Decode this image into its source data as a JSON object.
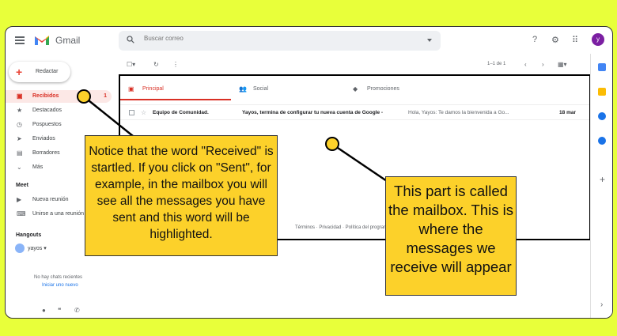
{
  "header": {
    "app_title": "Gmail",
    "search_placeholder": "Buscar correo",
    "avatar_letter": "y"
  },
  "sidebar": {
    "compose_label": "Redactar",
    "items": [
      {
        "label": "Recibidos",
        "count": "1",
        "icon": "inbox-icon"
      },
      {
        "label": "Destacados",
        "icon": "star-icon"
      },
      {
        "label": "Pospuestos",
        "icon": "clock-icon"
      },
      {
        "label": "Enviados",
        "icon": "send-icon"
      },
      {
        "label": "Borradores",
        "icon": "draft-icon"
      },
      {
        "label": "Más",
        "icon": "chevron-down-icon"
      }
    ],
    "meet": {
      "title": "Meet",
      "items": [
        {
          "label": "Nueva reunión"
        },
        {
          "label": "Unirse a una reunión"
        }
      ]
    },
    "hangouts": {
      "title": "Hangouts",
      "user": "yayos",
      "no_chats": "No hay chats recientes",
      "start_new": "Iniciar uno nuevo"
    }
  },
  "toolbar": {
    "page_count": "1–1 de 1"
  },
  "mailbox": {
    "tabs": [
      {
        "label": "Principal",
        "icon": "inbox-icon"
      },
      {
        "label": "Social",
        "icon": "people-icon"
      },
      {
        "label": "Promociones",
        "icon": "tag-icon"
      }
    ],
    "rows": [
      {
        "sender": "Equipo de Comunidad.",
        "subject": "Yayos, termina de configurar tu nueva cuenta de Google -",
        "snippet": "Hola, Yayos: Te damos la bienvenida a Go...",
        "date": "18 mar"
      }
    ],
    "footer": "Términos · Privacidad · Política del programa"
  },
  "annotations": {
    "callout_left": "Notice that the word \"Received\" is startled. If you click on \"Sent\", for example, in the mailbox you will see all the messages you have sent and this word will be highlighted.",
    "callout_right": "This part is called the mailbox. This is where the messages we receive will appear"
  },
  "colors": {
    "background": "#e8ff3a",
    "callout": "#fcd12a",
    "accent_red": "#d93025",
    "active_bg": "#fce8e6"
  }
}
